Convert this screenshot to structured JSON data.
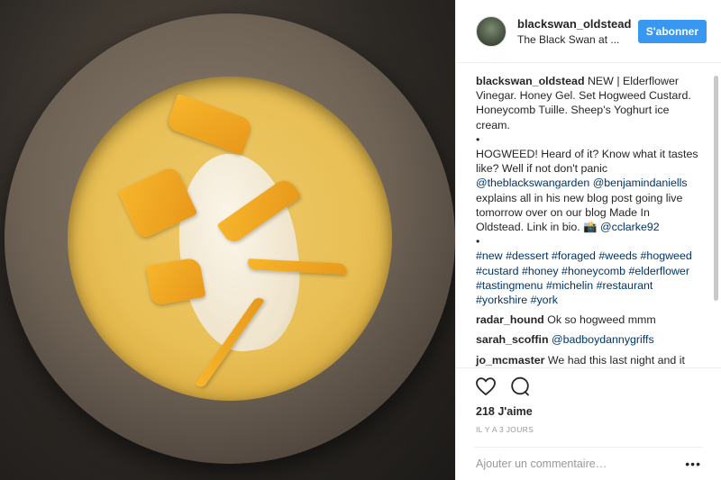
{
  "header": {
    "username": "blackswan_oldstead",
    "location": "The Black Swan at ...",
    "follow_label": "S'abonner"
  },
  "caption": {
    "username": "blackswan_oldstead",
    "part1": "NEW | Elderflower Vinegar. Honey Gel. Set Hogweed Custard. Honeycomb Tuille. Sheep's Yoghurt ice cream.",
    "bullet": "•",
    "part2": "HOGWEED! Heard of it? Know what it tastes like? Well if not don't panic",
    "mention1": "@theblackswangarden",
    "mention2": "@benjamindaniells",
    "part3": "explains all in his new blog post going live tomorrow over on our blog Made In Oldstead. Link in bio. 📸",
    "mention3": "@cclarke92",
    "hashtags": "#new #dessert #foraged #weeds #hogweed #custard #honey #honeycomb #elderflower #tastingmenu #michelin #restaurant #yorkshire #york"
  },
  "comments": [
    {
      "user": "radar_hound",
      "text": "Ok so hogweed mmm"
    },
    {
      "user": "sarah_scoffin",
      "mention": "@badboydannygriffs",
      "text": ""
    },
    {
      "user": "jo_mcmaster",
      "text": "We had this last night and it was amazing!!"
    }
  ],
  "stats": {
    "likes": "218 J'aime",
    "time": "IL Y A 3 JOURS"
  },
  "add_comment": {
    "placeholder": "Ajouter un commentaire…",
    "more": "•••"
  }
}
